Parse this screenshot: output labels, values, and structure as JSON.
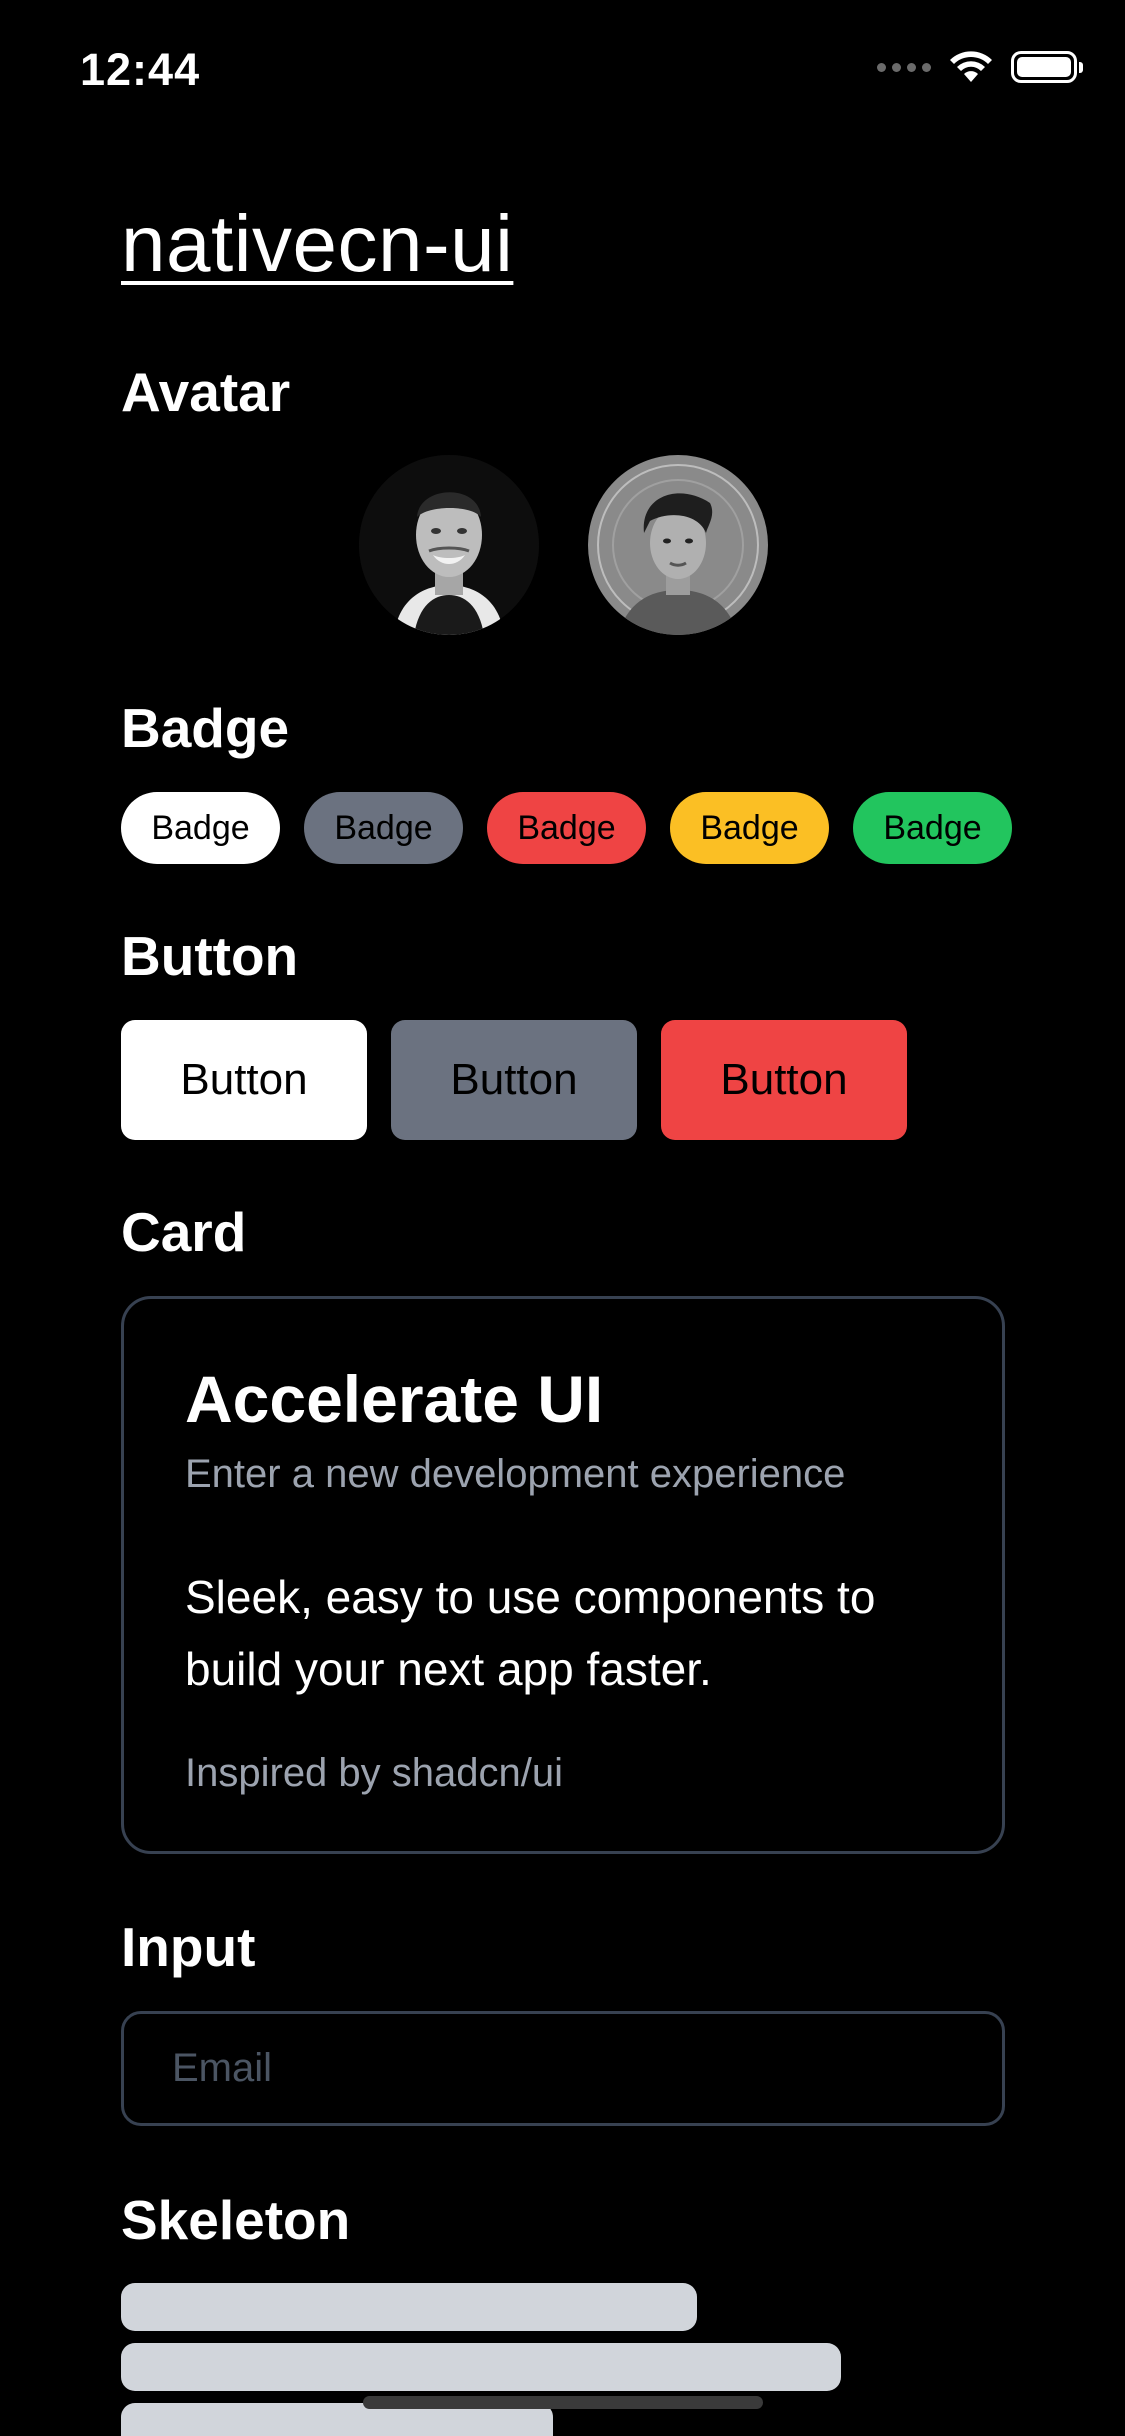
{
  "status_bar": {
    "time": "12:44"
  },
  "app": {
    "title": "nativecn-ui"
  },
  "sections": {
    "avatar": "Avatar",
    "badge": "Badge",
    "button": "Button",
    "card": "Card",
    "input": "Input",
    "skeleton": "Skeleton"
  },
  "badges": [
    {
      "label": "Badge",
      "color": "#ffffff"
    },
    {
      "label": "Badge",
      "color": "#6b7280"
    },
    {
      "label": "Badge",
      "color": "#ef4444"
    },
    {
      "label": "Badge",
      "color": "#fbbf24"
    },
    {
      "label": "Badge",
      "color": "#22c55e"
    }
  ],
  "buttons": [
    {
      "label": "Button",
      "color": "#ffffff"
    },
    {
      "label": "Button",
      "color": "#6b7280"
    },
    {
      "label": "Button",
      "color": "#ef4444"
    }
  ],
  "card": {
    "title": "Accelerate UI",
    "description": "Enter a new development experience",
    "body": "Sleek, easy to use components to build your next app faster.",
    "footer": "Inspired by shadcn/ui"
  },
  "input": {
    "placeholder": "Email",
    "value": ""
  },
  "colors": {
    "background": "#000000",
    "border": "#374151",
    "muted_text": "#9ca3af",
    "skeleton": "#d1d5db"
  }
}
